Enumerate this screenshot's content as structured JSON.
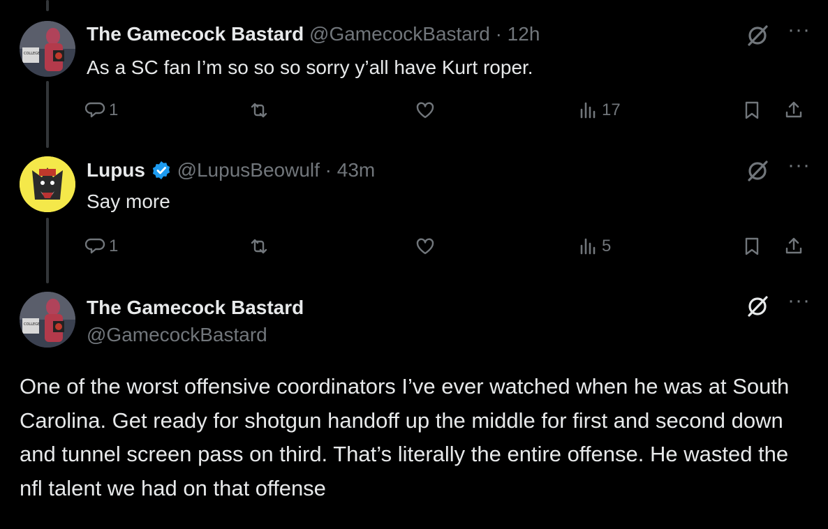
{
  "replies": [
    {
      "name": "The Gamecock Bastard",
      "handle": "@GamecockBastard",
      "separator": "·",
      "time": "12h",
      "text": "As a SC fan I’m so so so sorry y’all have Kurt roper.",
      "replies_count": "1",
      "views": "17",
      "avatar": "gamecock-avatar"
    },
    {
      "name": "Lupus",
      "verified": true,
      "handle": "@LupusBeowulf",
      "separator": "·",
      "time": "43m",
      "text": "Say more",
      "replies_count": "1",
      "views": "5",
      "avatar": "wolf-avatar"
    }
  ],
  "main_post": {
    "name": "The Gamecock Bastard",
    "handle": "@GamecockBastard",
    "text": "One of the worst offensive coordinators I’ve ever watched when he was at South Carolina. Get ready for shotgun handoff up the middle for first and second down and tunnel screen pass on third. That’s literally the entire offense. He wasted the nfl talent we had on that offense"
  },
  "icons": [
    "reply-icon",
    "retweet-icon",
    "like-icon",
    "views-icon",
    "bookmark-icon",
    "share-icon",
    "grok-icon",
    "more-icon",
    "verified-badge-icon"
  ],
  "colors": {
    "background": "#000000",
    "text": "#e7e9ea",
    "muted": "#71767b",
    "verified": "#1d9bf0",
    "thread_line": "#333639"
  }
}
